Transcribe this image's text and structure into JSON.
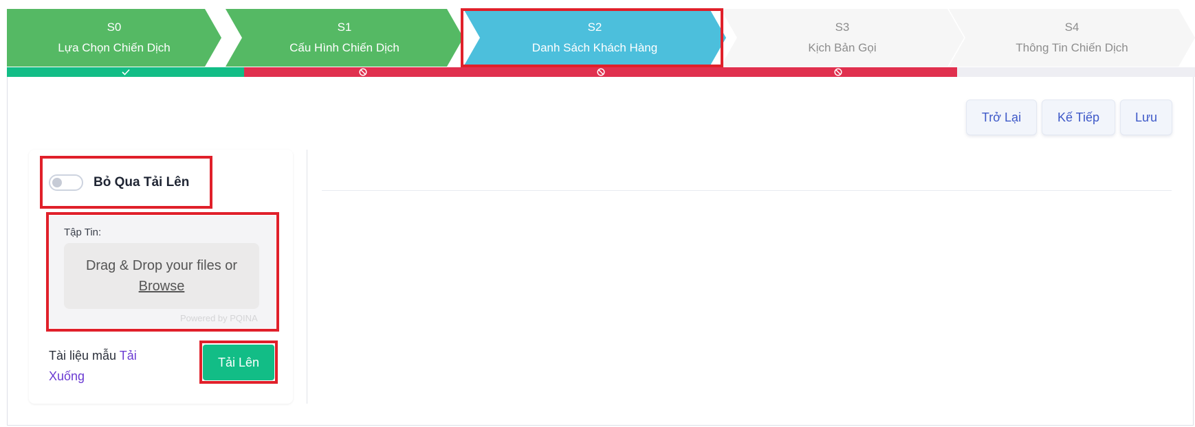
{
  "stepper": {
    "steps": [
      {
        "code": "S0",
        "title": "Lựa Chọn Chiến Dịch",
        "status": "done"
      },
      {
        "code": "S1",
        "title": "Cấu Hình Chiến Dịch",
        "status": "done"
      },
      {
        "code": "S2",
        "title": "Danh Sách Khách Hàng",
        "status": "active"
      },
      {
        "code": "S3",
        "title": "Kịch Bản Gọi",
        "status": "todo"
      },
      {
        "code": "S4",
        "title": "Thông Tin Chiến Dịch",
        "status": "todo"
      }
    ]
  },
  "progress": {
    "segments": [
      {
        "status": "ok",
        "icon": "check-icon"
      },
      {
        "status": "blocked",
        "icon": "ban-icon"
      },
      {
        "status": "blocked",
        "icon": "ban-icon"
      },
      {
        "status": "blocked",
        "icon": "ban-icon"
      },
      {
        "status": "pending",
        "icon": ""
      }
    ]
  },
  "nav": {
    "back_label": "Trở Lại",
    "next_label": "Kế Tiếp",
    "save_label": "Lưu"
  },
  "upload": {
    "skip_label": "Bỏ Qua Tải Lên",
    "skip_enabled": false,
    "file_label": "Tập Tin:",
    "drop_text": "Drag & Drop your files or",
    "browse_label": "Browse",
    "powered_by": "Powered by PQINA",
    "sample_text": "Tài liệu mẫu",
    "download_label": "Tải Xuống",
    "upload_button": "Tải Lên"
  },
  "colors": {
    "done": "#55b964",
    "active": "#4cbfdc",
    "todo": "#f6f6f6",
    "ok": "#12bd86",
    "blocked": "#e0304e",
    "highlight": "#e0202a",
    "link": "#6a3ad2"
  }
}
